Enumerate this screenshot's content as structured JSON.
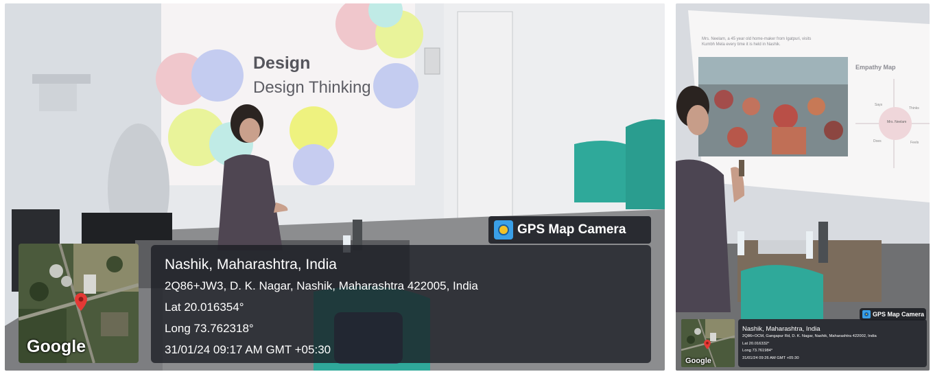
{
  "left_photo": {
    "slide": {
      "title": "Design",
      "subtitle": "Design Thinking"
    },
    "gps_badge": "GPS Map Camera",
    "map_attribution": "Google",
    "location": {
      "place": "Nashik, Maharashtra, India",
      "address": "2Q86+JW3, D. K. Nagar, Nashik, Maharashtra 422005, India",
      "latitude": "Lat 20.016354°",
      "longitude": "Long 73.762318°",
      "datetime": "31/01/24 09:17 AM GMT +05:30"
    }
  },
  "right_photo": {
    "slide": {
      "caption": "Mrs. Neelam, a 45 year old home-maker from Igatpuri, visits Kumbh Mela every time it is held in Nashik.",
      "heading": "Empathy Map",
      "center_label": "Mrs. Neelam",
      "quadrants": [
        "Says",
        "Thinks",
        "Does",
        "Feels"
      ]
    },
    "gps_badge": "GPS Map Camera",
    "map_attribution": "Google",
    "location": {
      "place": "Nashik, Maharashtra, India",
      "address": "2Q86+OCM, Gangapur Rd, D. K. Nagar, Nashik, Maharashtra 422002, India",
      "latitude": "Lat 20.016332°",
      "longitude": "Long 73.761984°",
      "datetime": "31/01/24 09:26 AM GMT +05:30"
    }
  },
  "colors": {
    "overlay": "#1c1e24",
    "badge_icon": "#3aa0e8",
    "map_pin": "#e53935",
    "chair": "#2fa99a"
  },
  "icons": [
    "gps-map-camera-icon",
    "map-pin-icon"
  ]
}
